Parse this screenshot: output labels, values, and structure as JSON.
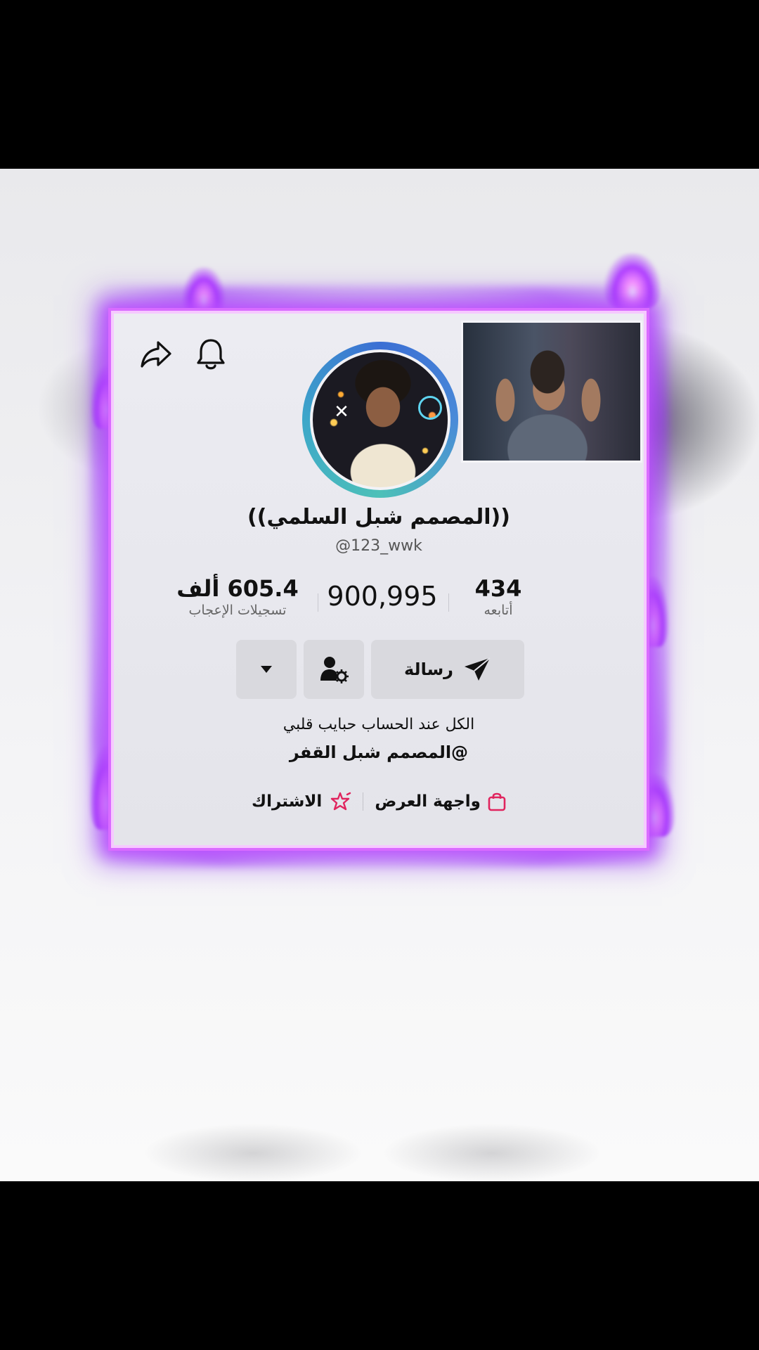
{
  "profile": {
    "display_name": "((المصمم شبل السلمي))",
    "username": "@123_wwk"
  },
  "stats": {
    "following": {
      "value": "434",
      "label": "أتابعه"
    },
    "followers": {
      "value": "900,995",
      "label": ""
    },
    "likes": {
      "value": "605.4 ألف",
      "label": "تسجيلات الإعجاب"
    }
  },
  "actions": {
    "message_label": "رسالة",
    "profile_settings_icon": "user-gear-icon",
    "more_icon": "caret-down-icon"
  },
  "header": {
    "notification_icon": "bell-icon",
    "share_icon": "share-icon"
  },
  "bio": {
    "line1": "الكل عند الحساب حبايب قلبي",
    "line2": "@المصمم شبل القفر"
  },
  "links": {
    "showcase_label": "واجهة العرض",
    "subscribe_label": "الاشتراك"
  },
  "colors": {
    "neon_frame": "#b040ff",
    "showcase_icon": "#e0245e",
    "subscribe_icon": "#e0245e"
  }
}
